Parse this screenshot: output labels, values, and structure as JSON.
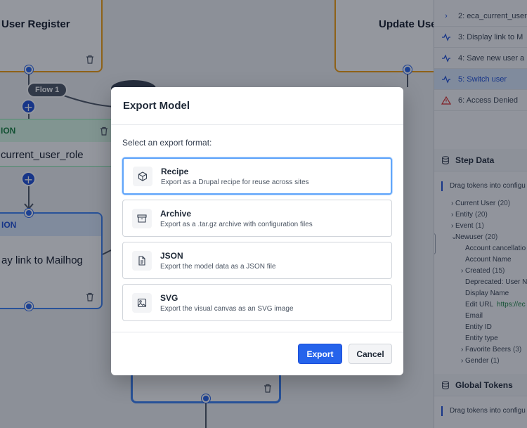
{
  "canvas": {
    "nodes": {
      "user_register": {
        "title": "User Register"
      },
      "update_user": {
        "title": "Update User"
      },
      "condition": {
        "header": "ION",
        "label": "current_user_role"
      },
      "action": {
        "header": "ION",
        "label": "ay link to Mailhog"
      }
    },
    "flow_label": "Flow 1",
    "plus_symbol": "+"
  },
  "panel": {
    "steps": [
      {
        "label": "2: eca_current_user",
        "icon": "chevron-right-icon",
        "state": "normal"
      },
      {
        "label": "3: Display link to M",
        "icon": "activity-icon",
        "state": "normal"
      },
      {
        "label": "4: Save new user a",
        "icon": "activity-icon",
        "state": "normal"
      },
      {
        "label": "5: Switch user",
        "icon": "activity-icon",
        "state": "active"
      },
      {
        "label": "6: Access Denied",
        "icon": "warning-icon",
        "state": "error"
      }
    ],
    "step_data": {
      "title": "Step Data",
      "hint": "Drag tokens into configu",
      "tree": [
        {
          "label": "Current User",
          "count": "(20)",
          "expander": "›",
          "level": 0
        },
        {
          "label": "Entity",
          "count": "(20)",
          "expander": "›",
          "level": 0
        },
        {
          "label": "Event",
          "count": "(1)",
          "expander": "›",
          "level": 0
        },
        {
          "label": "Newuser",
          "count": "(20)",
          "expander": "⌄",
          "level": 0
        },
        {
          "label": "Account cancellatio",
          "count": "",
          "expander": "",
          "level": 1
        },
        {
          "label": "Account Name",
          "count": "",
          "expander": "",
          "level": 1
        },
        {
          "label": "Created",
          "count": "(15)",
          "expander": "›",
          "level": 1
        },
        {
          "label": "Deprecated: User N",
          "count": "",
          "expander": "",
          "level": 1
        },
        {
          "label": "Display Name",
          "count": "",
          "expander": "",
          "level": 1
        },
        {
          "label": "Edit URL",
          "count": "",
          "link": "https://ec",
          "expander": "",
          "level": 1
        },
        {
          "label": "Email",
          "count": "",
          "expander": "",
          "level": 1
        },
        {
          "label": "Entity ID",
          "count": "",
          "expander": "",
          "level": 1
        },
        {
          "label": "Entity type",
          "count": "",
          "expander": "",
          "level": 1
        },
        {
          "label": "Favorite Beers",
          "count": "(3)",
          "expander": "›",
          "level": 1
        },
        {
          "label": "Gender",
          "count": "(1)",
          "expander": "›",
          "level": 1
        }
      ]
    },
    "global_tokens": {
      "title": "Global Tokens",
      "hint": "Drag tokens into configu"
    }
  },
  "modal": {
    "title": "Export Model",
    "prompt": "Select an export format:",
    "options": [
      {
        "name": "Recipe",
        "description": "Export as a Drupal recipe for reuse across sites",
        "icon": "package-icon",
        "selected": true
      },
      {
        "name": "Archive",
        "description": "Export as a .tar.gz archive with configuration files",
        "icon": "archive-icon",
        "selected": false
      },
      {
        "name": "JSON",
        "description": "Export the model data as a JSON file",
        "icon": "file-text-icon",
        "selected": false
      },
      {
        "name": "SVG",
        "description": "Export the visual canvas as an SVG image",
        "icon": "image-icon",
        "selected": false
      }
    ],
    "export_label": "Export",
    "cancel_label": "Cancel"
  },
  "colors": {
    "primary": "#2563eb",
    "event_border": "#f59e0b",
    "condition_header": "#dcfce7",
    "action_border": "#3b82f6",
    "error": "#dc2626"
  }
}
